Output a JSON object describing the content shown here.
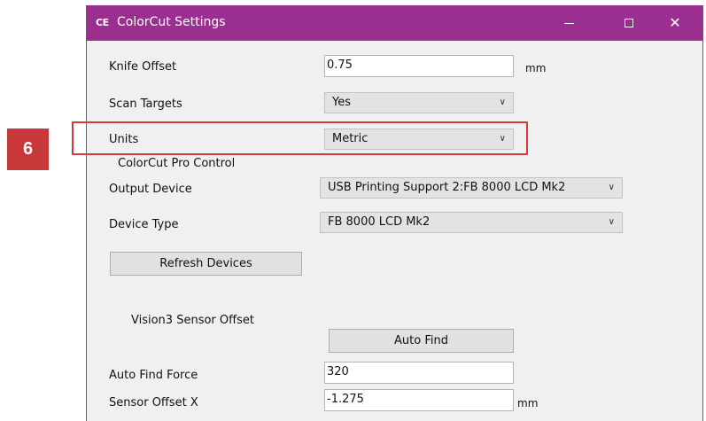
{
  "window": {
    "logo": "CE",
    "title": "ColorCut Settings",
    "controls": {
      "minimize": "—",
      "maximize": "☐",
      "close": "✕"
    }
  },
  "settings": {
    "knife_offset": {
      "label": "Knife Offset",
      "value": "0.75",
      "unit": "mm"
    },
    "scan_targets": {
      "label": "Scan Targets",
      "value": "Yes"
    },
    "units": {
      "label": "Units",
      "value": "Metric"
    }
  },
  "pro_control": {
    "heading": "ColorCut Pro Control",
    "output_device": {
      "label": "Output Device",
      "value": "USB Printing Support 2:FB 8000 LCD Mk2"
    },
    "device_type": {
      "label": "Device Type",
      "value": "FB 8000 LCD Mk2"
    },
    "refresh_label": "Refresh Devices"
  },
  "vision": {
    "heading": "Vision3 Sensor Offset",
    "auto_find_label": "Auto Find",
    "auto_find_force": {
      "label": "Auto Find Force",
      "value": "320"
    },
    "sensor_offset_x": {
      "label": "Sensor Offset X",
      "value": "-1.275",
      "unit": "mm"
    }
  },
  "callout": {
    "number": "6"
  },
  "colors": {
    "titlebar": "#9b2f8f",
    "highlight": "#d63a3a",
    "badge": "#c8373a"
  }
}
